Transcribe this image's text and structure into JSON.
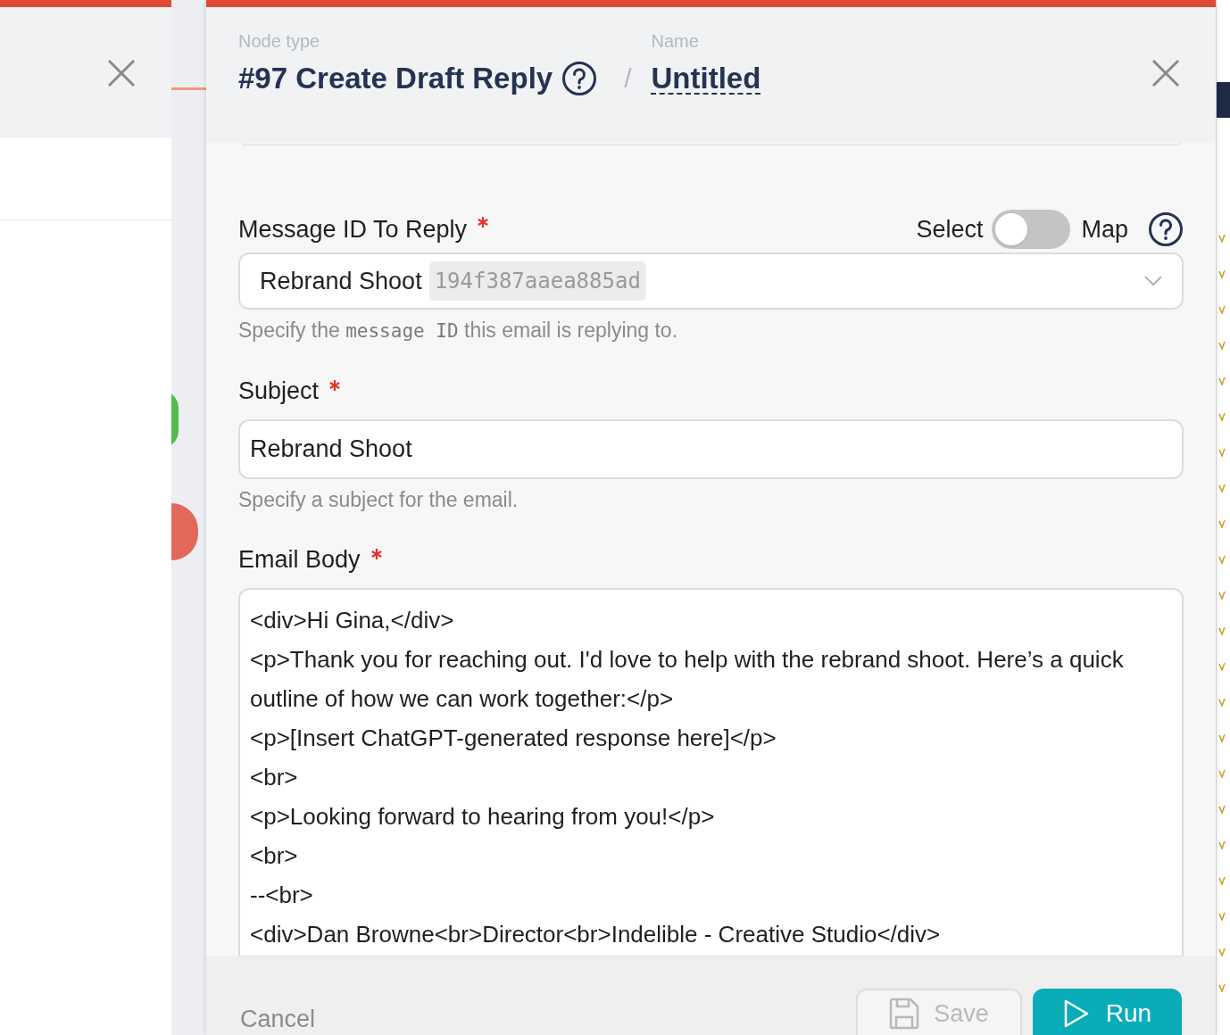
{
  "header": {
    "node_type_label": "Node type",
    "node_type": "#97 Create Draft Reply",
    "separator": "/",
    "name_label": "Name",
    "name": "Untitled"
  },
  "fields": [
    {
      "kind": "select",
      "label": "Message ID To Reply",
      "required": true,
      "mode_toggle": {
        "left": "Select",
        "right": "Map",
        "on": false
      },
      "value": "Rebrand Shoot",
      "tag": "194f387aaea885ad",
      "help": [
        {
          "text": "Specify the ",
          "code": false
        },
        {
          "text": "message ID",
          "code": true
        },
        {
          "text": " this email is replying to.",
          "code": false
        }
      ]
    },
    {
      "kind": "text",
      "label": "Subject",
      "required": true,
      "value": "Rebrand Shoot",
      "help": [
        {
          "text": "Specify a subject for the email.",
          "code": false
        }
      ]
    },
    {
      "kind": "textarea",
      "label": "Email Body",
      "required": true,
      "value": "<div>Hi Gina,</div>\n<p>Thank you for reaching out. I'd love to help with the rebrand shoot. Here’s a quick outline of how we can work together:</p>\n<p>[Insert ChatGPT-generated response here]</p>\n<br>\n<p>Looking forward to hearing from you!</p>\n<br>\n--<br>\n<div>Dan Browne<br>Director<br>Indelible - Creative Studio</div>"
    }
  ],
  "footer": {
    "cancel": "Cancel",
    "save": {
      "label": "Save",
      "disabled": true
    },
    "run": "Run"
  }
}
